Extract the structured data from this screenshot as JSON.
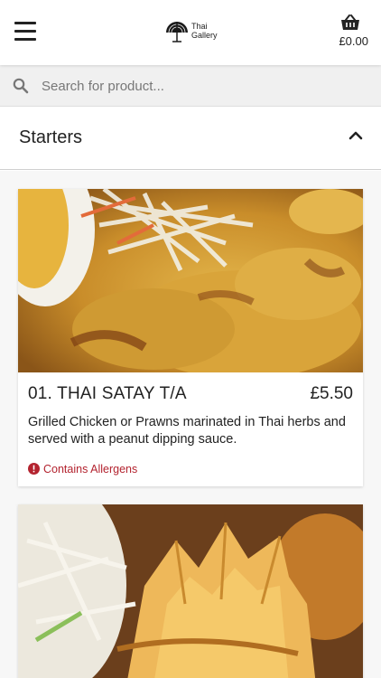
{
  "header": {
    "logo_line1": "Thai",
    "logo_line2": "Gallery",
    "cart_total": "£0.00"
  },
  "search": {
    "placeholder": "Search for product..."
  },
  "category": {
    "title": "Starters"
  },
  "products": [
    {
      "name": "01. THAI SATAY T/A",
      "price": "£5.50",
      "description": "Grilled Chicken or Prawns marinated in Thai herbs and served with a peanut dipping sauce.",
      "allergens_label": "Contains Allergens"
    }
  ],
  "colors": {
    "allergen": "#b3232f",
    "header_bg": "#ffffff",
    "search_bg": "#f0f0f0"
  }
}
